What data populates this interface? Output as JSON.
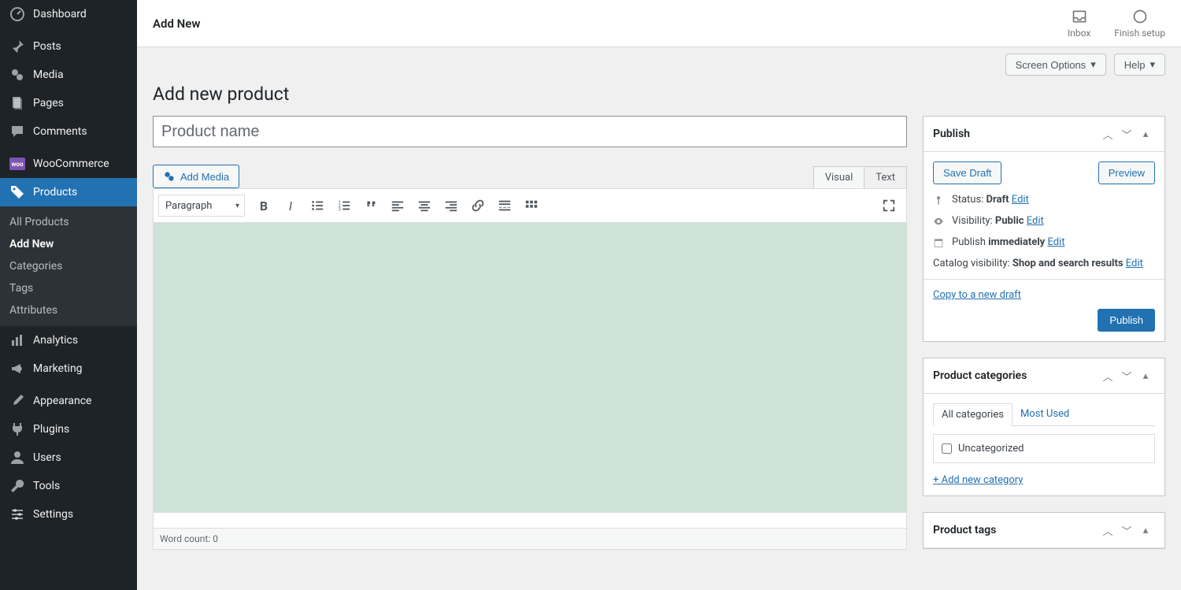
{
  "topbar": {
    "title": "Add New",
    "inbox": "Inbox",
    "finish": "Finish setup"
  },
  "tabs": {
    "screen_options": "Screen Options",
    "help": "Help"
  },
  "page_title": "Add new product",
  "title_placeholder": "Product name",
  "sidebar": {
    "dashboard": "Dashboard",
    "posts": "Posts",
    "media": "Media",
    "pages": "Pages",
    "comments": "Comments",
    "woocommerce": "WooCommerce",
    "products": "Products",
    "analytics": "Analytics",
    "marketing": "Marketing",
    "appearance": "Appearance",
    "plugins": "Plugins",
    "users": "Users",
    "tools": "Tools",
    "settings": "Settings",
    "sub": {
      "all": "All Products",
      "add": "Add New",
      "cats": "Categories",
      "tags": "Tags",
      "attrs": "Attributes"
    }
  },
  "editor": {
    "add_media": "Add Media",
    "visual": "Visual",
    "text": "Text",
    "paragraph": "Paragraph",
    "word_count_label": "Word count: ",
    "word_count": "0"
  },
  "publish": {
    "heading": "Publish",
    "save_draft": "Save Draft",
    "preview": "Preview",
    "status_label": "Status: ",
    "status_value": "Draft",
    "visibility_label": "Visibility: ",
    "visibility_value": "Public",
    "publish_label": "Publish ",
    "publish_value": "immediately",
    "catalog_label": "Catalog visibility: ",
    "catalog_value": "Shop and search results",
    "edit": "Edit",
    "copy": "Copy to a new draft",
    "publish_btn": "Publish"
  },
  "categories": {
    "heading": "Product categories",
    "all": "All categories",
    "most_used": "Most Used",
    "uncategorized": "Uncategorized",
    "add_new": "+ Add new category"
  },
  "tags_box": {
    "heading": "Product tags"
  }
}
